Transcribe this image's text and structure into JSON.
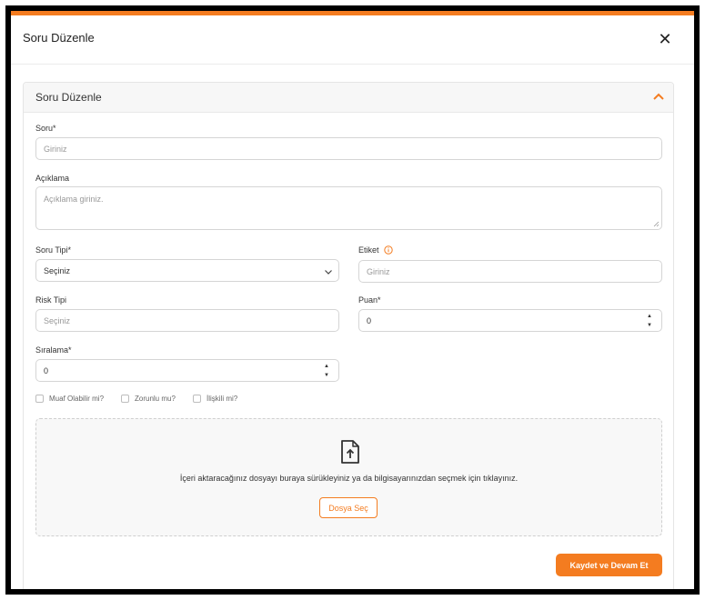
{
  "modal": {
    "title": "Soru Düzenle",
    "close_glyph": "✕"
  },
  "section": {
    "title": "Soru Düzenle"
  },
  "fields": {
    "soru": {
      "label": "Soru*",
      "placeholder": "Giriniz"
    },
    "aciklama": {
      "label": "Açıklama",
      "placeholder": "Açıklama giriniz."
    },
    "soru_tipi": {
      "label": "Soru Tipi*",
      "value": "Seçiniz"
    },
    "etiket": {
      "label": "Etiket",
      "placeholder": "Giriniz"
    },
    "risk_tipi": {
      "label": "Risk Tipi",
      "placeholder": "Seçiniz"
    },
    "puan": {
      "label": "Puan*",
      "value": "0"
    },
    "siralama": {
      "label": "Sıralama*",
      "value": "0"
    }
  },
  "checkboxes": [
    {
      "label": "Muaf Olabilir mi?",
      "checked": false
    },
    {
      "label": "Zorunlu mu?",
      "checked": false
    },
    {
      "label": "İlişkili mi?",
      "checked": false
    }
  ],
  "upload": {
    "text": "İçeri aktaracağınız dosyayı buraya sürükleyiniz ya da bilgisayarınızdan seçmek için tıklayınız.",
    "button_label": "Dosya Seç"
  },
  "actions": {
    "submit_label": "Kaydet ve Devam Et"
  },
  "colors": {
    "accent": "#f47c20"
  },
  "spinner": {
    "up": "▲",
    "down": "▼"
  }
}
